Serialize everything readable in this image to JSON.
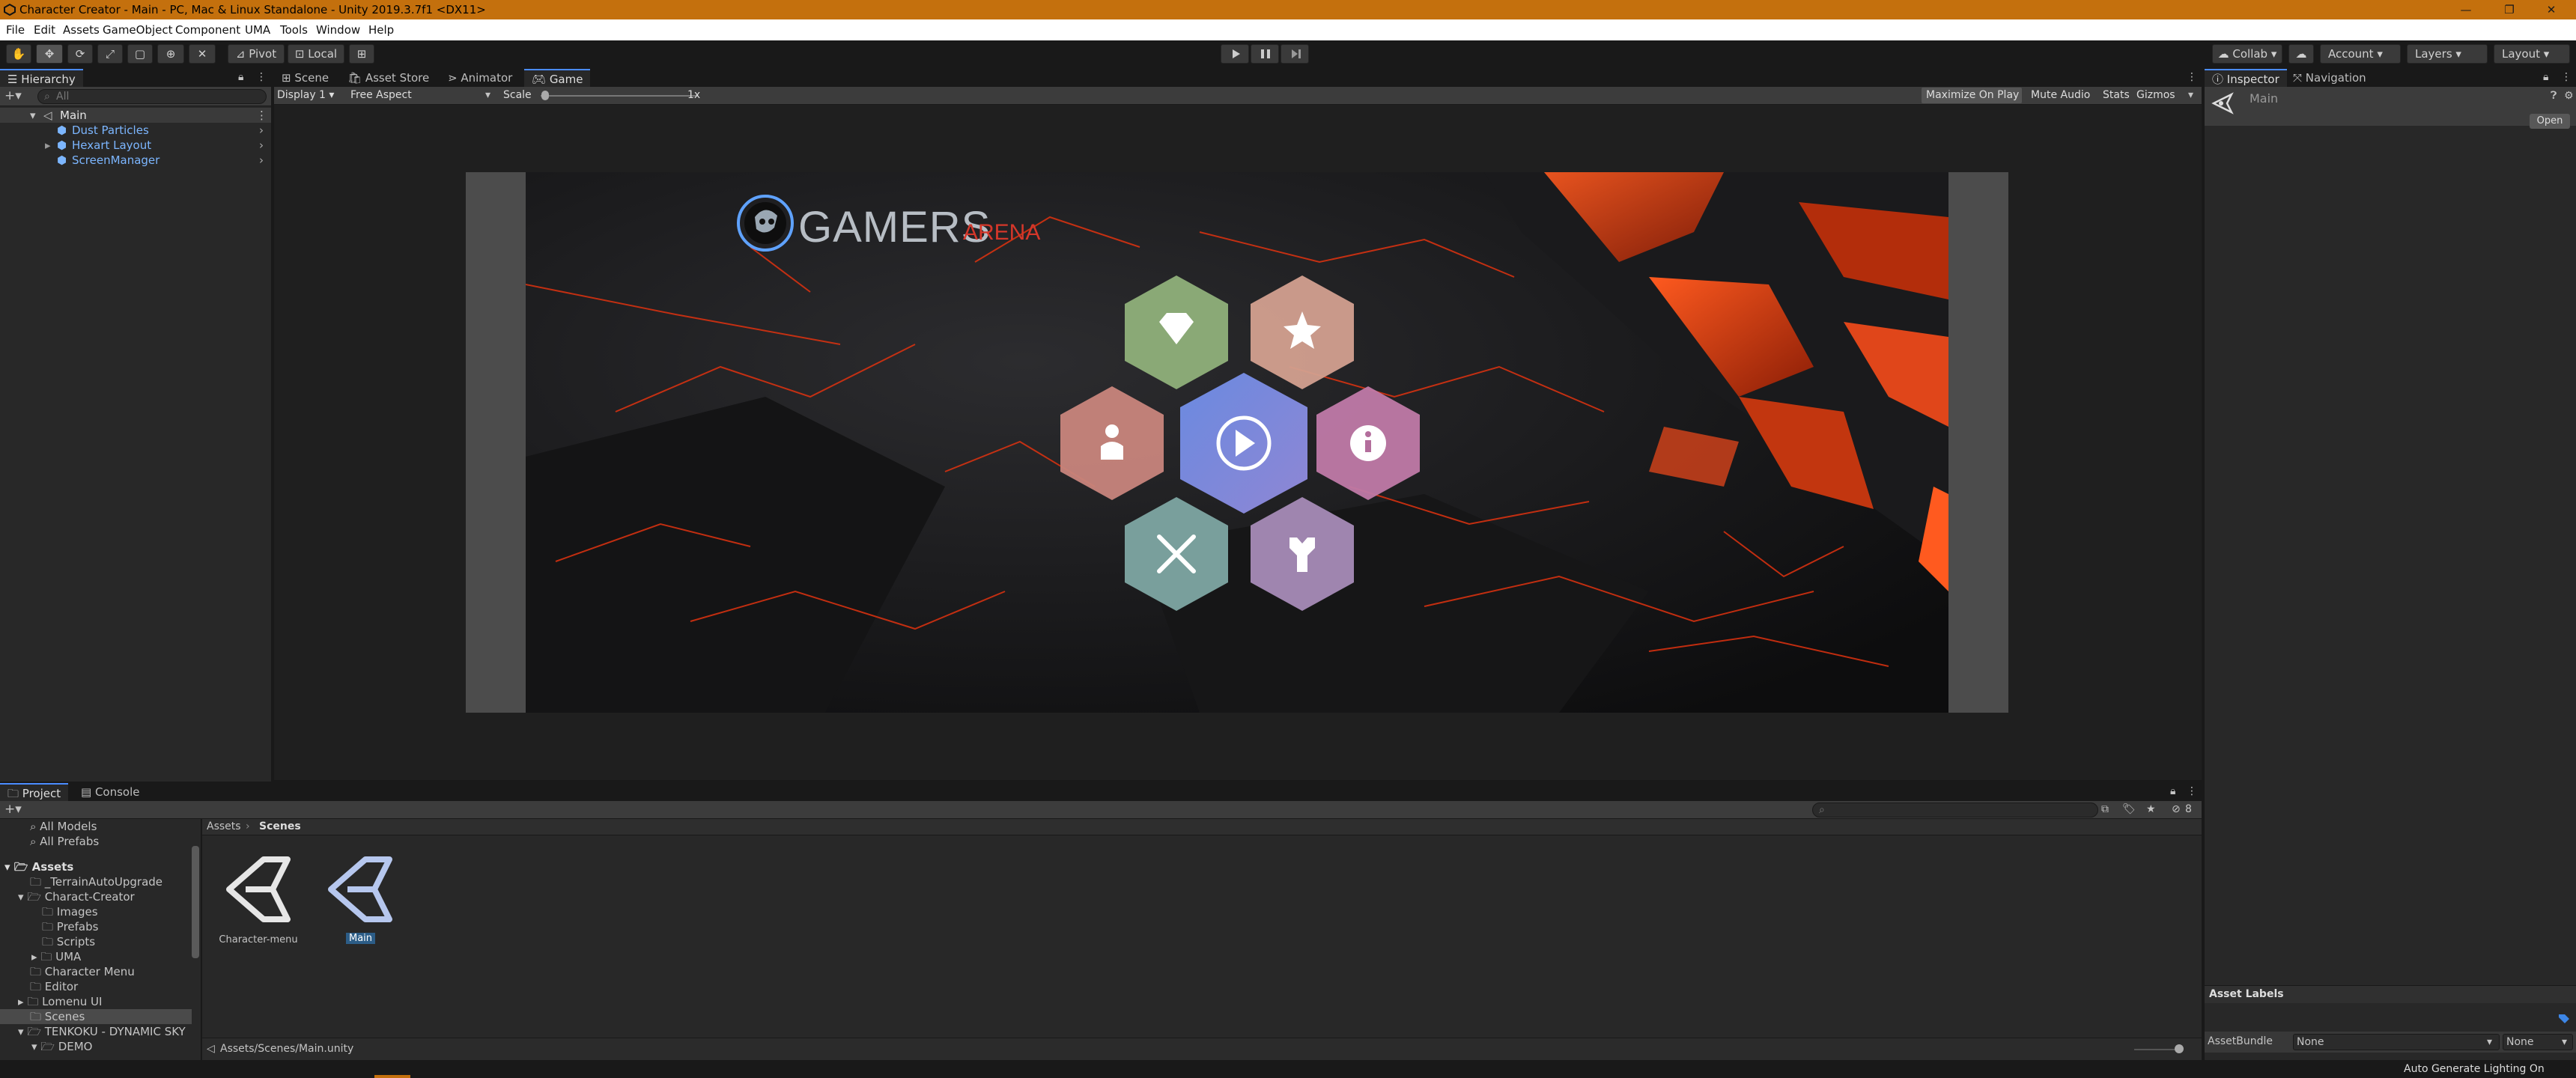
{
  "window": {
    "title": "Character Creator - Main - PC, Mac & Linux Standalone - Unity 2019.3.7f1 <DX11>",
    "minimize": "—",
    "maximize": "❐",
    "close": "✕"
  },
  "menu": [
    "File",
    "Edit",
    "Assets",
    "GameObject",
    "Component",
    "UMA",
    "Tools",
    "Window",
    "Help"
  ],
  "toolbar": {
    "pivot": "Pivot",
    "local": "Local",
    "collab": "Collab",
    "account": "Account",
    "layers": "Layers",
    "layout": "Layout"
  },
  "hierarchy": {
    "tab": "Hierarchy",
    "search_placeholder": "All",
    "scene": "Main",
    "items": [
      "Dust Particles",
      "Hexart Layout",
      "ScreenManager"
    ]
  },
  "game_view": {
    "tabs": [
      "Scene",
      "Asset Store",
      "Animator",
      "Game"
    ],
    "display": "Display 1",
    "aspect": "Free Aspect",
    "scale_label": "Scale",
    "scale_value": "1x",
    "options": [
      "Maximize On Play",
      "Mute Audio",
      "Stats",
      "Gizmos"
    ],
    "logo_main": "GAMERS",
    "logo_sub": "ARENA"
  },
  "inspector": {
    "tabs": [
      "Inspector",
      "Navigation"
    ],
    "object_name": "Main",
    "open_button": "Open",
    "asset_labels": "Asset Labels",
    "assetbundle_label": "AssetBundle",
    "assetbundle_value": "None",
    "assetbundle_variant": "None"
  },
  "project": {
    "tabs": [
      "Project",
      "Console"
    ],
    "favorites": [
      "All Models",
      "All Prefabs"
    ],
    "tree": [
      {
        "label": "Assets",
        "depth": 0,
        "bold": true
      },
      {
        "label": "_TerrainAutoUpgrade",
        "depth": 1
      },
      {
        "label": "Charact-Creator",
        "depth": 1
      },
      {
        "label": "Images",
        "depth": 2
      },
      {
        "label": "Prefabs",
        "depth": 2
      },
      {
        "label": "Scripts",
        "depth": 2
      },
      {
        "label": "UMA",
        "depth": 2
      },
      {
        "label": "Character Menu",
        "depth": 1
      },
      {
        "label": "Editor",
        "depth": 1
      },
      {
        "label": "Lomenu UI",
        "depth": 1
      },
      {
        "label": "Scenes",
        "depth": 1,
        "selected": true
      },
      {
        "label": "TENKOKU - DYNAMIC SKY",
        "depth": 1
      },
      {
        "label": "DEMO",
        "depth": 2
      }
    ],
    "breadcrumb": [
      "Assets",
      "Scenes"
    ],
    "assets": [
      {
        "name": "Character-menu",
        "selected": false
      },
      {
        "name": "Main",
        "selected": true
      }
    ],
    "path": "Assets/Scenes/Main.unity",
    "hidden_count": "8"
  },
  "status": {
    "text": "Auto Generate Lighting On"
  },
  "colors": {
    "accent": "#4a8cff",
    "titlebar": "#c4700d",
    "hex_green": "#8fb07a",
    "hex_peach": "#d3a08f",
    "hex_rose": "#c8857c",
    "hex_blue": "#6d86d8",
    "hex_pink": "#c07aa8",
    "hex_teal": "#7ea7a3",
    "hex_lilac": "#a78bb7"
  }
}
